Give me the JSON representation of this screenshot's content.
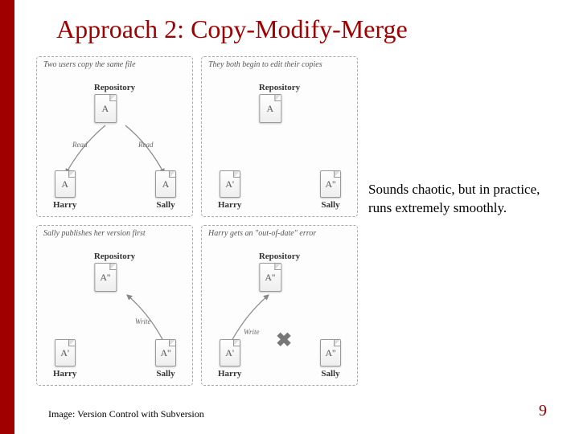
{
  "title": "Approach 2: Copy-Modify-Merge",
  "caption": "Sounds chaotic, but in practice, runs extremely smoothly.",
  "credit": "Image: Version Control with Subversion",
  "page_number": "9",
  "repo_label": "Repository",
  "users": {
    "left": "Harry",
    "right": "Sally"
  },
  "panels": [
    {
      "caption": "Two users copy the same file",
      "repo_doc": "A",
      "left_doc": "A",
      "right_doc": "A",
      "arrow_left_label": "Read",
      "arrow_right_label": "Read",
      "arrows": "down-both"
    },
    {
      "caption": "They both begin to edit their copies",
      "repo_doc": "A",
      "left_doc": "A'",
      "right_doc": "A''",
      "arrows": "none"
    },
    {
      "caption": "Sally publishes her version first",
      "repo_doc": "A''",
      "left_doc": "A'",
      "right_doc": "A''",
      "arrow_right_label": "Write",
      "arrows": "up-right"
    },
    {
      "caption": "Harry gets an \"out-of-date\" error",
      "repo_doc": "A''",
      "left_doc": "A'",
      "right_doc": "A''",
      "arrow_left_label": "Write",
      "arrows": "up-left-fail"
    }
  ]
}
